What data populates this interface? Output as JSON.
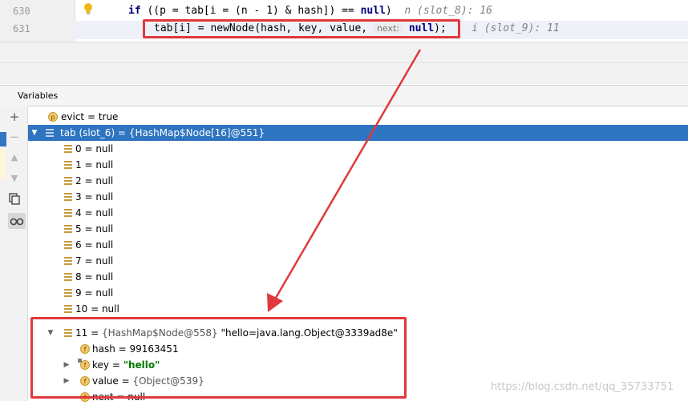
{
  "editor": {
    "lines": [
      {
        "number": "630",
        "kw": "if",
        "code": " ((p = tab[i = (n - 1) & hash]) == ",
        "kw2": "null",
        "code_end": ")",
        "hint": "n (slot_8): 16"
      },
      {
        "number": "631",
        "code": "tab[i] = newNode(hash, key, value, ",
        "inlay": "next:",
        "kw": "null",
        "code_end": ");",
        "hint": "i (slot_9): 11"
      }
    ]
  },
  "panel": {
    "title": "Variables",
    "toolbar": [
      "plus-icon",
      "minus-icon",
      "up-icon",
      "down-icon",
      "copy-icon",
      "glasses-icon"
    ]
  },
  "variables": {
    "evict": {
      "name": "evict",
      "value": "true"
    },
    "tab": {
      "label": "tab (slot_6) = {HashMap$Node[16]@551}"
    },
    "elements": [
      "0 = null",
      "1 = null",
      "2 = null",
      "3 = null",
      "4 = null",
      "5 = null",
      "6 = null",
      "7 = null",
      "8 = null",
      "9 = null",
      "10 = null"
    ],
    "node11": {
      "index": "11 = ",
      "type": "{HashMap$Node@558}",
      "value": " \"hello=java.lang.Object@3339ad8e\"",
      "fields": {
        "hash": {
          "name": "hash = ",
          "value": "99163451"
        },
        "key": {
          "name": "key = ",
          "value": "\"hello\""
        },
        "value": {
          "name": "value = ",
          "value": "{Object@539}"
        },
        "next": {
          "name": "next = ",
          "value": "null"
        }
      }
    }
  },
  "watermark": "https://blog.csdn.net/qq_35733751",
  "colors": {
    "selection": "#2f74c0",
    "annotation": "#e0383c",
    "keyword": "#000080"
  }
}
